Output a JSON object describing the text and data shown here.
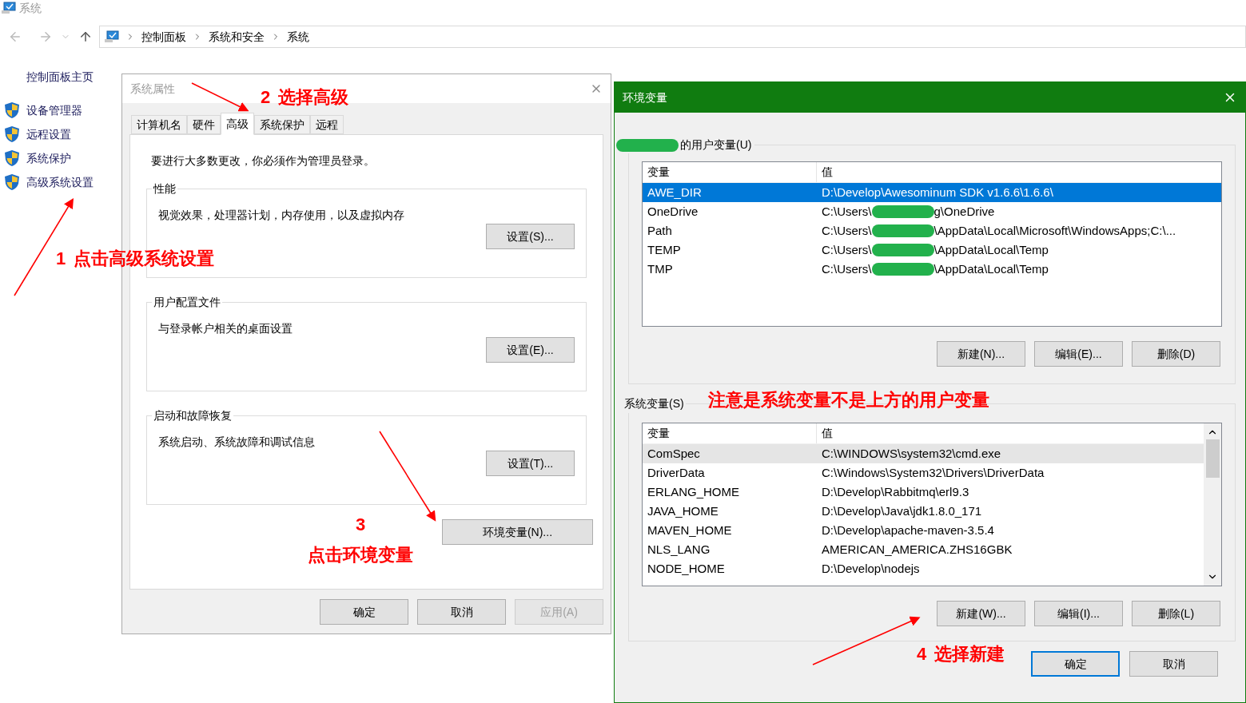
{
  "window": {
    "title": "系统"
  },
  "breadcrumb": [
    "控制面板",
    "系统和安全",
    "系统"
  ],
  "sidebar": {
    "home": "控制面板主页",
    "items": [
      "设备管理器",
      "远程设置",
      "系统保护",
      "高级系统设置"
    ]
  },
  "system_properties": {
    "title": "系统属性",
    "tabs": [
      {
        "label": "计算机名",
        "selected": false
      },
      {
        "label": "硬件",
        "selected": false
      },
      {
        "label": "高级",
        "selected": true
      },
      {
        "label": "系统保护",
        "selected": false
      },
      {
        "label": "远程",
        "selected": false
      }
    ],
    "notice": "要进行大多数更改，你必须作为管理员登录。",
    "groups": [
      {
        "title": "性能",
        "description": "视觉效果，处理器计划，内存使用，以及虚拟内存",
        "button": "设置(S)..."
      },
      {
        "title": "用户配置文件",
        "description": "与登录帐户相关的桌面设置",
        "button": "设置(E)..."
      },
      {
        "title": "启动和故障恢复",
        "description": "系统启动、系统故障和调试信息",
        "button": "设置(T)..."
      }
    ],
    "env_button": "环境变量(N)...",
    "buttons": [
      {
        "label": "确定",
        "disabled": false
      },
      {
        "label": "取消",
        "disabled": false
      },
      {
        "label": "应用(A)",
        "disabled": true
      }
    ]
  },
  "env_vars": {
    "title": "环境变量",
    "user_section": {
      "label": "的用户变量(U)",
      "columns": [
        "变量",
        "值"
      ],
      "rows": [
        {
          "name": "AWE_DIR",
          "value": [
            "D:\\Develop\\Awesominum SDK v1.6.6\\1.6.6\\"
          ],
          "selected": true
        },
        {
          "name": "OneDrive",
          "value": [
            "C:\\Users\\",
            "g\\OneDrive"
          ],
          "selected": false
        },
        {
          "name": "Path",
          "value": [
            "C:\\Users\\",
            "\\AppData\\Local\\Microsoft\\WindowsApps;C:\\..."
          ],
          "selected": false
        },
        {
          "name": "TEMP",
          "value": [
            "C:\\Users\\",
            "\\AppData\\Local\\Temp"
          ],
          "selected": false
        },
        {
          "name": "TMP",
          "value": [
            "C:\\Users\\",
            "\\AppData\\Local\\Temp"
          ],
          "selected": false
        }
      ],
      "buttons": [
        "新建(N)...",
        "编辑(E)...",
        "删除(D)"
      ]
    },
    "system_section": {
      "label": "系统变量(S)",
      "columns": [
        "变量",
        "值"
      ],
      "rows": [
        {
          "name": "ComSpec",
          "value": [
            "C:\\WINDOWS\\system32\\cmd.exe"
          ],
          "selected": true
        },
        {
          "name": "DriverData",
          "value": [
            "C:\\Windows\\System32\\Drivers\\DriverData"
          ],
          "selected": false
        },
        {
          "name": "ERLANG_HOME",
          "value": [
            "D:\\Develop\\Rabbitmq\\erl9.3"
          ],
          "selected": false
        },
        {
          "name": "JAVA_HOME",
          "value": [
            "D:\\Develop\\Java\\jdk1.8.0_171"
          ],
          "selected": false
        },
        {
          "name": "MAVEN_HOME",
          "value": [
            "D:\\Develop\\apache-maven-3.5.4"
          ],
          "selected": false
        },
        {
          "name": "NLS_LANG",
          "value": [
            "AMERICAN_AMERICA.ZHS16GBK"
          ],
          "selected": false
        },
        {
          "name": "NODE_HOME",
          "value": [
            "D:\\Develop\\nodejs"
          ],
          "selected": false
        }
      ],
      "buttons": [
        "新建(W)...",
        "编辑(I)...",
        "删除(L)"
      ]
    },
    "buttons": [
      {
        "label": "确定",
        "default": true
      },
      {
        "label": "取消",
        "default": false
      }
    ]
  },
  "annotations": [
    {
      "number": "1",
      "text": "点击高级系统设置"
    },
    {
      "number": "2",
      "text": "选择高级"
    },
    {
      "number": "3",
      "text": "点击环境变量"
    },
    {
      "text": "注意是系统变量不是上方的用户变量"
    },
    {
      "number": "4",
      "text": "选择新建"
    }
  ]
}
